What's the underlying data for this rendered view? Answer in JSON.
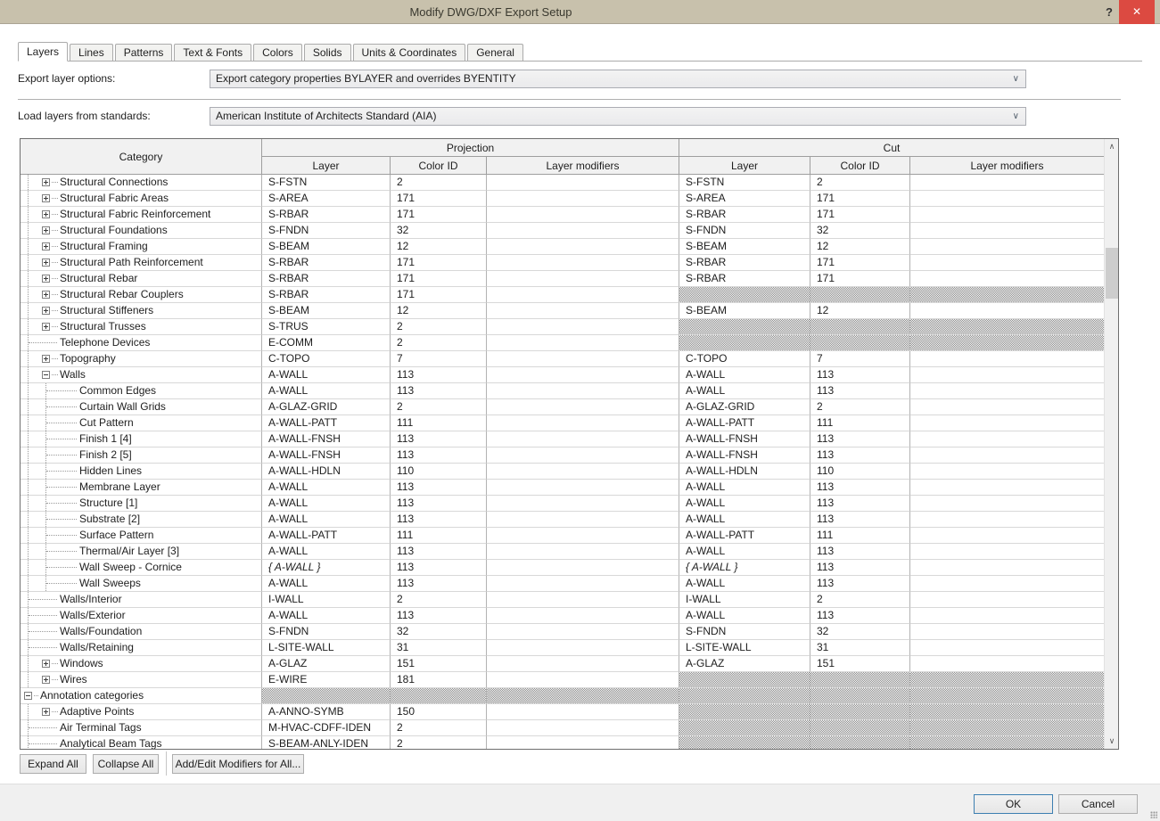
{
  "window": {
    "title": "Modify DWG/DXF Export Setup"
  },
  "icons": {
    "help": "?",
    "close": "✕",
    "scroll_up": "∧",
    "scroll_down": "∨",
    "dropdown": "∨"
  },
  "colors": {
    "titlebar": "#c8c1ac",
    "close_red": "#dc4a41",
    "hatch_gray": "#8d8d8d",
    "focus_blue": "#3c7fb1"
  },
  "tabs": [
    {
      "label": "Layers",
      "active": true
    },
    {
      "label": "Lines",
      "active": false
    },
    {
      "label": "Patterns",
      "active": false
    },
    {
      "label": "Text & Fonts",
      "active": false
    },
    {
      "label": "Colors",
      "active": false
    },
    {
      "label": "Solids",
      "active": false
    },
    {
      "label": "Units & Coordinates",
      "active": false
    },
    {
      "label": "General",
      "active": false
    }
  ],
  "form": {
    "export_layer_options": {
      "label": "Export layer options:",
      "value": "Export category properties BYLAYER and overrides BYENTITY"
    },
    "load_layers": {
      "label": "Load layers from standards:",
      "value": "American Institute of Architects Standard (AIA)"
    }
  },
  "table": {
    "header": {
      "category": "Category",
      "projection": "Projection",
      "cut": "Cut",
      "layer": "Layer",
      "color_id": "Color ID",
      "layer_modifiers": "Layer modifiers"
    },
    "rows": [
      {
        "label": "Structural Connections",
        "indent": 1,
        "expand": "plus",
        "projection": {
          "layer": "S-FSTN",
          "color_id": "2",
          "modifiers": ""
        },
        "cut": {
          "layer": "S-FSTN",
          "color_id": "2",
          "modifiers": ""
        }
      },
      {
        "label": "Structural Fabric Areas",
        "indent": 1,
        "expand": "plus",
        "projection": {
          "layer": "S-AREA",
          "color_id": "171",
          "modifiers": ""
        },
        "cut": {
          "layer": "S-AREA",
          "color_id": "171",
          "modifiers": ""
        }
      },
      {
        "label": "Structural Fabric Reinforcement",
        "indent": 1,
        "expand": "plus",
        "projection": {
          "layer": "S-RBAR",
          "color_id": "171",
          "modifiers": ""
        },
        "cut": {
          "layer": "S-RBAR",
          "color_id": "171",
          "modifiers": ""
        }
      },
      {
        "label": "Structural Foundations",
        "indent": 1,
        "expand": "plus",
        "projection": {
          "layer": "S-FNDN",
          "color_id": "32",
          "modifiers": ""
        },
        "cut": {
          "layer": "S-FNDN",
          "color_id": "32",
          "modifiers": ""
        }
      },
      {
        "label": "Structural Framing",
        "indent": 1,
        "expand": "plus",
        "projection": {
          "layer": "S-BEAM",
          "color_id": "12",
          "modifiers": ""
        },
        "cut": {
          "layer": "S-BEAM",
          "color_id": "12",
          "modifiers": ""
        }
      },
      {
        "label": "Structural Path Reinforcement",
        "indent": 1,
        "expand": "plus",
        "projection": {
          "layer": "S-RBAR",
          "color_id": "171",
          "modifiers": ""
        },
        "cut": {
          "layer": "S-RBAR",
          "color_id": "171",
          "modifiers": ""
        }
      },
      {
        "label": "Structural Rebar",
        "indent": 1,
        "expand": "plus",
        "projection": {
          "layer": "S-RBAR",
          "color_id": "171",
          "modifiers": ""
        },
        "cut": {
          "layer": "S-RBAR",
          "color_id": "171",
          "modifiers": ""
        }
      },
      {
        "label": "Structural Rebar Couplers",
        "indent": 1,
        "expand": "plus",
        "projection": {
          "layer": "S-RBAR",
          "color_id": "171",
          "modifiers": ""
        },
        "cut": null
      },
      {
        "label": "Structural Stiffeners",
        "indent": 1,
        "expand": "plus",
        "projection": {
          "layer": "S-BEAM",
          "color_id": "12",
          "modifiers": ""
        },
        "cut": {
          "layer": "S-BEAM",
          "color_id": "12",
          "modifiers": ""
        }
      },
      {
        "label": "Structural Trusses",
        "indent": 1,
        "expand": "plus",
        "projection": {
          "layer": "S-TRUS",
          "color_id": "2",
          "modifiers": ""
        },
        "cut": null
      },
      {
        "label": "Telephone Devices",
        "indent": 1,
        "expand": "none",
        "projection": {
          "layer": "E-COMM",
          "color_id": "2",
          "modifiers": ""
        },
        "cut": null
      },
      {
        "label": "Topography",
        "indent": 1,
        "expand": "plus",
        "projection": {
          "layer": "C-TOPO",
          "color_id": "7",
          "modifiers": ""
        },
        "cut": {
          "layer": "C-TOPO",
          "color_id": "7",
          "modifiers": ""
        }
      },
      {
        "label": "Walls",
        "indent": 1,
        "expand": "minus",
        "projection": {
          "layer": "A-WALL",
          "color_id": "113",
          "modifiers": ""
        },
        "cut": {
          "layer": "A-WALL",
          "color_id": "113",
          "modifiers": ""
        }
      },
      {
        "label": "Common Edges",
        "indent": 2,
        "expand": "none",
        "projection": {
          "layer": "A-WALL",
          "color_id": "113",
          "modifiers": ""
        },
        "cut": {
          "layer": "A-WALL",
          "color_id": "113",
          "modifiers": ""
        }
      },
      {
        "label": "Curtain Wall Grids",
        "indent": 2,
        "expand": "none",
        "projection": {
          "layer": "A-GLAZ-GRID",
          "color_id": "2",
          "modifiers": ""
        },
        "cut": {
          "layer": "A-GLAZ-GRID",
          "color_id": "2",
          "modifiers": ""
        }
      },
      {
        "label": "Cut Pattern",
        "indent": 2,
        "expand": "none",
        "projection": {
          "layer": "A-WALL-PATT",
          "color_id": "111",
          "modifiers": ""
        },
        "cut": {
          "layer": "A-WALL-PATT",
          "color_id": "111",
          "modifiers": ""
        }
      },
      {
        "label": "Finish 1 [4]",
        "indent": 2,
        "expand": "none",
        "projection": {
          "layer": "A-WALL-FNSH",
          "color_id": "113",
          "modifiers": ""
        },
        "cut": {
          "layer": "A-WALL-FNSH",
          "color_id": "113",
          "modifiers": ""
        }
      },
      {
        "label": "Finish 2 [5]",
        "indent": 2,
        "expand": "none",
        "projection": {
          "layer": "A-WALL-FNSH",
          "color_id": "113",
          "modifiers": ""
        },
        "cut": {
          "layer": "A-WALL-FNSH",
          "color_id": "113",
          "modifiers": ""
        }
      },
      {
        "label": "Hidden Lines",
        "indent": 2,
        "expand": "none",
        "projection": {
          "layer": "A-WALL-HDLN",
          "color_id": "110",
          "modifiers": ""
        },
        "cut": {
          "layer": "A-WALL-HDLN",
          "color_id": "110",
          "modifiers": ""
        }
      },
      {
        "label": "Membrane Layer",
        "indent": 2,
        "expand": "none",
        "projection": {
          "layer": "A-WALL",
          "color_id": "113",
          "modifiers": ""
        },
        "cut": {
          "layer": "A-WALL",
          "color_id": "113",
          "modifiers": ""
        }
      },
      {
        "label": "Structure [1]",
        "indent": 2,
        "expand": "none",
        "projection": {
          "layer": "A-WALL",
          "color_id": "113",
          "modifiers": ""
        },
        "cut": {
          "layer": "A-WALL",
          "color_id": "113",
          "modifiers": ""
        }
      },
      {
        "label": "Substrate [2]",
        "indent": 2,
        "expand": "none",
        "projection": {
          "layer": "A-WALL",
          "color_id": "113",
          "modifiers": ""
        },
        "cut": {
          "layer": "A-WALL",
          "color_id": "113",
          "modifiers": ""
        }
      },
      {
        "label": "Surface Pattern",
        "indent": 2,
        "expand": "none",
        "projection": {
          "layer": "A-WALL-PATT",
          "color_id": "111",
          "modifiers": ""
        },
        "cut": {
          "layer": "A-WALL-PATT",
          "color_id": "111",
          "modifiers": ""
        }
      },
      {
        "label": "Thermal/Air Layer [3]",
        "indent": 2,
        "expand": "none",
        "projection": {
          "layer": "A-WALL",
          "color_id": "113",
          "modifiers": ""
        },
        "cut": {
          "layer": "A-WALL",
          "color_id": "113",
          "modifiers": ""
        }
      },
      {
        "label": "Wall Sweep - Cornice",
        "indent": 2,
        "expand": "none",
        "projection": {
          "layer": "{ A-WALL }",
          "color_id": "113",
          "modifiers": ""
        },
        "cut": {
          "layer": "{ A-WALL }",
          "color_id": "113",
          "modifiers": ""
        }
      },
      {
        "label": "Wall Sweeps",
        "indent": 2,
        "expand": "none",
        "projection": {
          "layer": "A-WALL",
          "color_id": "113",
          "modifiers": ""
        },
        "cut": {
          "layer": "A-WALL",
          "color_id": "113",
          "modifiers": ""
        }
      },
      {
        "label": "Walls/Interior",
        "indent": 1,
        "expand": "none",
        "projection": {
          "layer": "I-WALL",
          "color_id": "2",
          "modifiers": ""
        },
        "cut": {
          "layer": "I-WALL",
          "color_id": "2",
          "modifiers": ""
        }
      },
      {
        "label": "Walls/Exterior",
        "indent": 1,
        "expand": "none",
        "projection": {
          "layer": "A-WALL",
          "color_id": "113",
          "modifiers": ""
        },
        "cut": {
          "layer": "A-WALL",
          "color_id": "113",
          "modifiers": ""
        }
      },
      {
        "label": "Walls/Foundation",
        "indent": 1,
        "expand": "none",
        "projection": {
          "layer": "S-FNDN",
          "color_id": "32",
          "modifiers": ""
        },
        "cut": {
          "layer": "S-FNDN",
          "color_id": "32",
          "modifiers": ""
        }
      },
      {
        "label": "Walls/Retaining",
        "indent": 1,
        "expand": "none",
        "projection": {
          "layer": "L-SITE-WALL",
          "color_id": "31",
          "modifiers": ""
        },
        "cut": {
          "layer": "L-SITE-WALL",
          "color_id": "31",
          "modifiers": ""
        }
      },
      {
        "label": "Windows",
        "indent": 1,
        "expand": "plus",
        "projection": {
          "layer": "A-GLAZ",
          "color_id": "151",
          "modifiers": ""
        },
        "cut": {
          "layer": "A-GLAZ",
          "color_id": "151",
          "modifiers": ""
        }
      },
      {
        "label": "Wires",
        "indent": 1,
        "expand": "plus",
        "projection": {
          "layer": "E-WIRE",
          "color_id": "181",
          "modifiers": ""
        },
        "cut": null
      },
      {
        "label": "Annotation categories",
        "indent": 0,
        "expand": "minus",
        "projection": null,
        "cut": null
      },
      {
        "label": "Adaptive Points",
        "indent": 1,
        "expand": "plus",
        "projection": {
          "layer": "A-ANNO-SYMB",
          "color_id": "150",
          "modifiers": ""
        },
        "cut": null
      },
      {
        "label": "Air Terminal Tags",
        "indent": 1,
        "expand": "none",
        "projection": {
          "layer": "M-HVAC-CDFF-IDEN",
          "color_id": "2",
          "modifiers": ""
        },
        "cut": null
      },
      {
        "label": "Analytical Beam Tags",
        "indent": 1,
        "expand": "none",
        "projection": {
          "layer": "S-BEAM-ANLY-IDEN",
          "color_id": "2",
          "modifiers": ""
        },
        "cut": null
      }
    ]
  },
  "buttons": {
    "expand_all": "Expand All",
    "collapse_all": "Collapse All",
    "add_edit_modifiers": "Add/Edit Modifiers for All...",
    "ok": "OK",
    "cancel": "Cancel"
  }
}
